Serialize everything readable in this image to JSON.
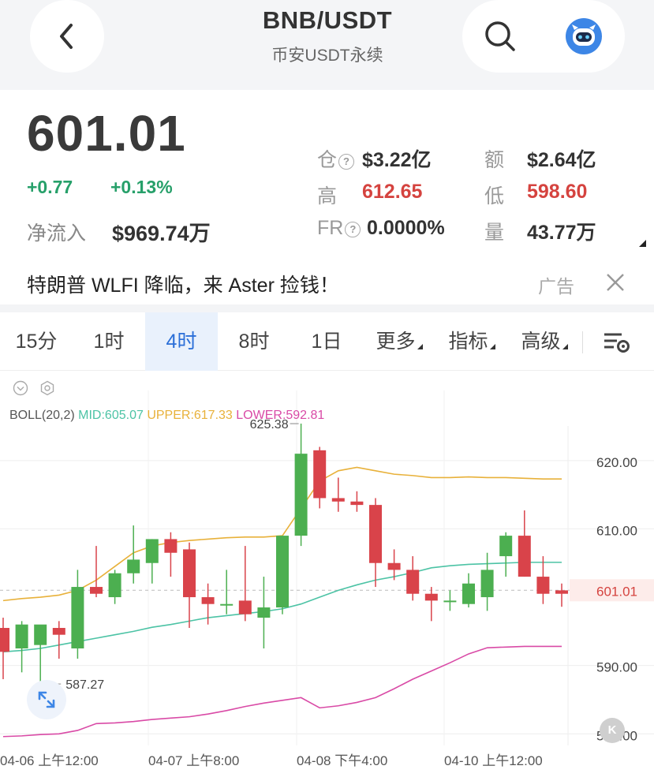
{
  "header": {
    "title": "BNB/USDT",
    "subtitle": "币安USDT永续",
    "back_icon": "chevron-left-icon",
    "search_icon": "search-icon",
    "assistant_icon": "robot-icon"
  },
  "quote": {
    "price": "601.01",
    "change": "+0.77",
    "change_pct": "+0.13%",
    "netflow_label": "净流入",
    "netflow_value": "$969.74万",
    "stats": [
      {
        "label": "仓",
        "value": "$3.22亿",
        "has_info": true
      },
      {
        "label": "额",
        "value": "$2.64亿"
      },
      {
        "label": "高",
        "value": "612.65",
        "color": "red"
      },
      {
        "label": "低",
        "value": "598.60",
        "color": "red"
      },
      {
        "label": "FR",
        "value": "0.0000%",
        "has_info": true
      },
      {
        "label": "量",
        "value": "43.77万"
      }
    ]
  },
  "ad": {
    "text": "特朗普 WLFI 降临，来 Aster 捡钱！",
    "tag": "广告",
    "close_icon": "close-icon"
  },
  "tabs": [
    {
      "label": "15分"
    },
    {
      "label": "1时"
    },
    {
      "label": "4时",
      "active": true
    },
    {
      "label": "8时"
    },
    {
      "label": "1日"
    },
    {
      "label": "更多",
      "dropdown": true
    },
    {
      "label": "指标",
      "dropdown": true
    },
    {
      "label": "高级",
      "dropdown": true
    }
  ],
  "colors": {
    "up": "#4caf50",
    "down": "#d9434a",
    "mid": "#4cc3a5",
    "upper": "#e8b13a",
    "lower": "#d94aa6",
    "active_tab": "#2b6fd8"
  },
  "chart_data": {
    "type": "candlestick",
    "indicator": {
      "name": "BOLL(20,2)",
      "mid_label": "MID:605.07",
      "upper_label": "UPPER:617.33",
      "lower_label": "LOWER:592.81"
    },
    "y_ticks": [
      "620.00",
      "610.00",
      "590.00",
      "580.00"
    ],
    "y_range": [
      578.3,
      629.1
    ],
    "x_ticks": [
      "04-06 上午12:00",
      "04-07 上午8:00",
      "04-08 下午4:00",
      "04-10 上午12:00"
    ],
    "current_price": "601.01",
    "max_label": "625.38",
    "min_label": "587.27",
    "candles": [
      {
        "o": 595.5,
        "h": 597.0,
        "l": 588.0,
        "c": 592.0
      },
      {
        "o": 592.5,
        "h": 596.5,
        "l": 589.0,
        "c": 596.0
      },
      {
        "o": 593.0,
        "h": 595.5,
        "l": 587.3,
        "c": 596.0
      },
      {
        "o": 595.5,
        "h": 596.5,
        "l": 591.0,
        "c": 594.5
      },
      {
        "o": 592.5,
        "h": 604.0,
        "l": 591.0,
        "c": 601.5
      },
      {
        "o": 601.5,
        "h": 607.5,
        "l": 600.0,
        "c": 600.5
      },
      {
        "o": 600.0,
        "h": 604.0,
        "l": 599.0,
        "c": 603.5
      },
      {
        "o": 603.5,
        "h": 610.5,
        "l": 602.0,
        "c": 605.5
      },
      {
        "o": 605.0,
        "h": 608.5,
        "l": 602.0,
        "c": 608.5
      },
      {
        "o": 608.5,
        "h": 609.5,
        "l": 603.0,
        "c": 606.5
      },
      {
        "o": 607.0,
        "h": 608.0,
        "l": 595.5,
        "c": 600.0
      },
      {
        "o": 600.0,
        "h": 602.0,
        "l": 596.0,
        "c": 599.0
      },
      {
        "o": 599.0,
        "h": 604.0,
        "l": 597.5,
        "c": 599.0
      },
      {
        "o": 599.5,
        "h": 607.5,
        "l": 596.5,
        "c": 597.5
      },
      {
        "o": 597.0,
        "h": 603.0,
        "l": 592.5,
        "c": 598.5
      },
      {
        "o": 598.5,
        "h": 609.0,
        "l": 597.5,
        "c": 609.0
      },
      {
        "o": 609.0,
        "h": 625.4,
        "l": 607.5,
        "c": 621.0
      },
      {
        "o": 621.5,
        "h": 622.0,
        "l": 613.0,
        "c": 614.5
      },
      {
        "o": 614.5,
        "h": 617.5,
        "l": 612.5,
        "c": 614.0
      },
      {
        "o": 614.0,
        "h": 615.5,
        "l": 612.5,
        "c": 613.5
      },
      {
        "o": 613.5,
        "h": 614.5,
        "l": 601.5,
        "c": 605.0
      },
      {
        "o": 605.0,
        "h": 607.0,
        "l": 602.5,
        "c": 604.0
      },
      {
        "o": 604.0,
        "h": 606.0,
        "l": 599.5,
        "c": 600.5
      },
      {
        "o": 600.5,
        "h": 601.5,
        "l": 596.5,
        "c": 599.5
      },
      {
        "o": 599.5,
        "h": 601.0,
        "l": 598.0,
        "c": 599.5
      },
      {
        "o": 599.0,
        "h": 603.5,
        "l": 598.5,
        "c": 602.0
      },
      {
        "o": 600.0,
        "h": 606.5,
        "l": 598.0,
        "c": 604.0
      },
      {
        "o": 606.0,
        "h": 609.5,
        "l": 603.0,
        "c": 609.0
      },
      {
        "o": 609.0,
        "h": 612.7,
        "l": 603.0,
        "c": 603.0
      },
      {
        "o": 603.0,
        "h": 606.0,
        "l": 599.0,
        "c": 600.5
      },
      {
        "o": 601.0,
        "h": 602.0,
        "l": 598.6,
        "c": 600.5
      }
    ],
    "boll_mid": [
      592.0,
      592.2,
      592.5,
      593.0,
      593.5,
      594.0,
      594.5,
      595.0,
      595.6,
      596.0,
      596.5,
      597.0,
      597.3,
      597.6,
      597.9,
      598.3,
      599.0,
      600.0,
      601.0,
      601.8,
      602.5,
      603.0,
      603.6,
      604.3,
      604.6,
      604.8,
      604.9,
      605.0,
      605.1,
      605.1,
      605.1
    ],
    "boll_upper": [
      599.5,
      599.8,
      600.0,
      600.3,
      601.0,
      602.5,
      604.5,
      606.5,
      607.5,
      608.0,
      608.3,
      608.5,
      608.7,
      608.8,
      608.8,
      609.0,
      613.0,
      617.0,
      618.5,
      619.0,
      618.5,
      618.0,
      617.8,
      617.5,
      617.5,
      617.6,
      617.5,
      617.5,
      617.4,
      617.3,
      617.3
    ],
    "boll_lower": [
      579.6,
      579.7,
      579.9,
      580.0,
      580.5,
      581.5,
      581.6,
      581.8,
      582.1,
      582.3,
      582.5,
      582.9,
      583.4,
      584.0,
      584.5,
      584.9,
      585.3,
      583.8,
      584.1,
      584.6,
      585.3,
      586.6,
      588.0,
      589.2,
      590.4,
      591.7,
      592.6,
      592.7,
      592.8,
      592.8,
      592.8
    ]
  }
}
